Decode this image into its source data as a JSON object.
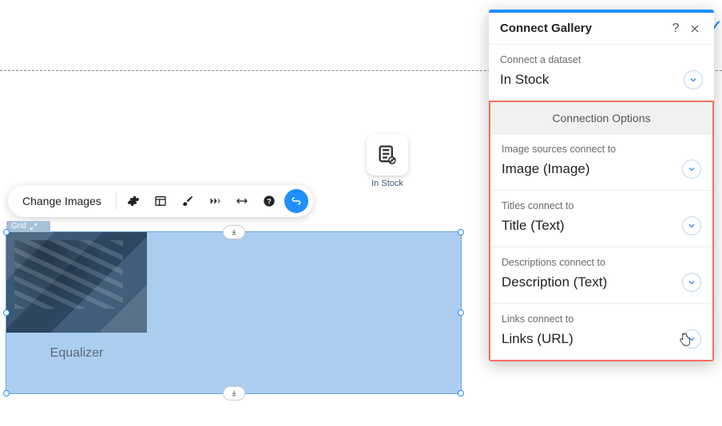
{
  "toolbar": {
    "change_images_label": "Change Images"
  },
  "dataset_chip": {
    "label": "In Stock"
  },
  "gallery": {
    "tag": "Grid",
    "items": [
      {
        "caption": "Equalizer"
      }
    ]
  },
  "panel": {
    "title": "Connect Gallery",
    "dataset_section": {
      "label": "Connect a dataset",
      "value": "In Stock"
    },
    "connection_options_header": "Connection Options",
    "options": [
      {
        "label": "Image sources connect to",
        "value": "Image (Image)"
      },
      {
        "label": "Titles connect to",
        "value": "Title (Text)"
      },
      {
        "label": "Descriptions connect to",
        "value": "Description (Text)"
      },
      {
        "label": "Links connect to",
        "value": "Links (URL)"
      }
    ]
  }
}
